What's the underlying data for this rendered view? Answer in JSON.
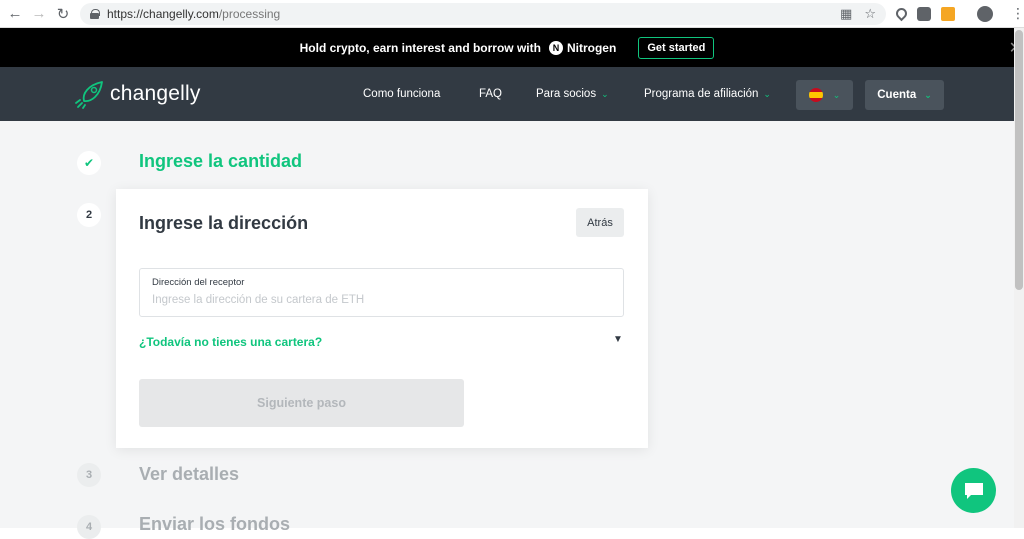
{
  "browser": {
    "url_host": "https://changelly.com",
    "url_path": "/processing"
  },
  "promo": {
    "text": "Hold crypto, earn interest and borrow with",
    "brand": "Nitrogen",
    "cta": "Get started"
  },
  "header": {
    "logo_text": "changelly",
    "nav": [
      {
        "label": "Como funciona"
      },
      {
        "label": "FAQ"
      },
      {
        "label": "Para socios"
      },
      {
        "label": "Programa de afiliación"
      }
    ],
    "account_label": "Cuenta"
  },
  "steps": {
    "step1": {
      "marker": "✔",
      "title": "Ingrese la cantidad"
    },
    "step2": {
      "marker": "2"
    },
    "step3": {
      "marker": "3",
      "title": "Ver detalles"
    },
    "step4": {
      "marker": "4",
      "title": "Enviar los fondos"
    }
  },
  "card": {
    "title": "Ingrese la dirección",
    "back_label": "Atrás",
    "field_label": "Dirección del receptor",
    "field_value": "",
    "field_placeholder": "Ingrese la dirección de su cartera de ETH",
    "wallet_link": "¿Todavía no tienes una cartera?",
    "next_label": "Siguiente paso"
  },
  "colors": {
    "accent": "#10c57e",
    "header_bg": "#323a43",
    "page_bg": "#f4f5f6"
  }
}
